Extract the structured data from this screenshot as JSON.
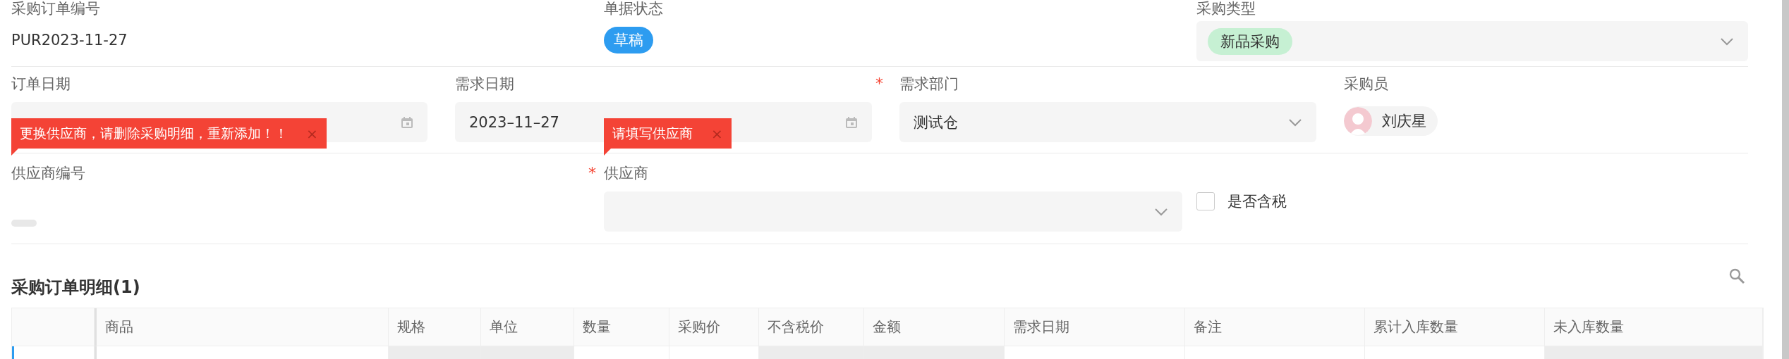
{
  "header_fields": [
    {
      "label": "采购订单编号",
      "kind": "text",
      "value": "PUR2023-11-27"
    },
    {
      "label": "单据状态",
      "kind": "status",
      "value": "草稿",
      "color": "#2d9cf0"
    },
    {
      "label": "采购类型",
      "kind": "tag-select",
      "value": "新品采购",
      "color": "#c6f0d3"
    }
  ],
  "date_fields": [
    {
      "label": "订单日期",
      "kind": "date"
    },
    {
      "label": "需求日期",
      "kind": "date",
      "value": "2023–11–27"
    },
    {
      "label": "需求部门",
      "kind": "select",
      "required_mark": "*",
      "value": "测试仓"
    },
    {
      "label": "采购员",
      "kind": "user",
      "value": "刘庆星"
    }
  ],
  "supplier_fields": [
    {
      "label": "供应商编号",
      "kind": "empty",
      "error": "更换供应商，请删除采购明细，重新添加！！",
      "error_close": "×"
    },
    {
      "label": "供应商",
      "kind": "select",
      "required_mark": "*",
      "error": "请填写供应商",
      "error_close": "×"
    },
    {
      "label": "是否含税",
      "kind": "checkbox",
      "checked": false
    }
  ],
  "details": {
    "title": "采购订单明细(1)",
    "columns": [
      {
        "readonly": false
      },
      {
        "label": "商品",
        "readonly": false
      },
      {
        "label": "规格",
        "readonly": true
      },
      {
        "label": "单位",
        "readonly": true
      },
      {
        "label": "数量",
        "readonly": false
      },
      {
        "label": "采购价",
        "readonly": false
      },
      {
        "label": "不含税价",
        "readonly": true
      },
      {
        "label": "金额",
        "readonly": true
      },
      {
        "label": "需求日期",
        "readonly": false
      },
      {
        "label": "备注",
        "readonly": false
      },
      {
        "label": "累计入库数量",
        "readonly": false
      },
      {
        "label": "未入库数量",
        "readonly": true
      }
    ]
  }
}
